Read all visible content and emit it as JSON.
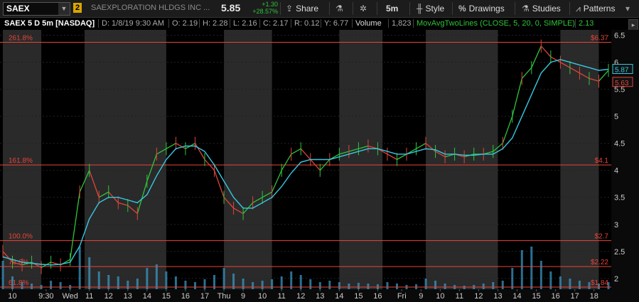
{
  "toolbar": {
    "symbol": "SAEX",
    "link_badge": "2",
    "company": "SAEXPLORATION HLDGS INC ...",
    "last": "5.85",
    "change_abs": "+1.30",
    "change_pct": "+28.57%",
    "share": "Share",
    "timeframe": "5m",
    "style": "Style",
    "drawings": "Drawings",
    "studies": "Studies",
    "patterns": "Patterns"
  },
  "info": {
    "title": "SAEX 5 D 5m [NASDAQ]",
    "d": "D: 1/8/19 9:30 AM",
    "o": "O: 2.19",
    "h": "H: 2.28",
    "l": "L: 2.16",
    "c": "C: 2.17",
    "r": "R: 0.12",
    "y": "Y: 6.77",
    "volume_label": "Volume",
    "volume_value": "1,823",
    "study": "MovAvgTwoLines (CLOSE, 5, 20, 0, SIMPLE)",
    "study_value": "2.13"
  },
  "colors": {
    "up": "#2fc43a",
    "down": "#e0443a",
    "ma_fast": "#e0443a",
    "ma_slow": "#37c8e0",
    "fib": "#e8443a",
    "volume": "#3aa0d0"
  },
  "chart_data": {
    "type": "line",
    "title": "SAEX 5 D 5m [NASDAQ]",
    "ylim": [
      1.8,
      6.6
    ],
    "y_ticks": [
      "2",
      "2.5",
      "3",
      "3.5",
      "4",
      "4.5",
      "5",
      "5.5",
      "6",
      "6.5"
    ],
    "y_tick_values": [
      2,
      2.5,
      3,
      3.5,
      4,
      4.5,
      5,
      5.5,
      6,
      6.5
    ],
    "x_tick_labels": [
      "10",
      "9:30",
      "Wed",
      "11",
      "12",
      "13",
      "14",
      "15",
      "16",
      "17",
      "Thu",
      "9",
      "10",
      "11",
      "12",
      "13",
      "14",
      "15",
      "16",
      "Fri",
      "9",
      "10",
      "11",
      "12",
      "13",
      "14",
      "15",
      "16",
      "17",
      "18"
    ],
    "x_tick_index": [
      4,
      18,
      28,
      36,
      44,
      52,
      60,
      68,
      76,
      84,
      92,
      100,
      108,
      116,
      124,
      132,
      140,
      148,
      156,
      166,
      174,
      182,
      190,
      198,
      206,
      214,
      222,
      230,
      238,
      246
    ],
    "fib_levels": [
      {
        "label": "261.8%",
        "price": 6.37,
        "price_label": "$6.37"
      },
      {
        "label": "161.8%",
        "price": 4.1,
        "price_label": "$4.1"
      },
      {
        "label": "100.0%",
        "price": 2.7,
        "price_label": "$2.7"
      },
      {
        "label": "78.6%",
        "price": 2.22,
        "price_label": "$2.22"
      },
      {
        "label": "61.8%",
        "price": 1.84,
        "price_label": "$1.84"
      }
    ],
    "price_tags": [
      {
        "value": 5.87,
        "text": "5.87",
        "color": "#37c8e0"
      },
      {
        "value": 5.63,
        "text": "5.63",
        "color": "#e0443a"
      }
    ],
    "shaded_ranges": [
      [
        0,
        16
      ],
      [
        34,
        68
      ],
      [
        92,
        112
      ],
      [
        140,
        158
      ],
      [
        176,
        206
      ],
      [
        232,
        248
      ]
    ],
    "x": [
      0,
      4,
      8,
      12,
      16,
      20,
      24,
      28,
      32,
      36,
      40,
      44,
      48,
      52,
      56,
      60,
      64,
      68,
      72,
      76,
      80,
      84,
      88,
      92,
      96,
      100,
      104,
      108,
      112,
      116,
      120,
      124,
      128,
      132,
      136,
      140,
      144,
      148,
      152,
      156,
      160,
      164,
      168,
      172,
      176,
      180,
      184,
      188,
      192,
      196,
      200,
      204,
      208,
      212,
      216,
      220,
      224,
      228,
      232,
      236,
      240,
      244,
      248,
      252
    ],
    "series": [
      {
        "name": "SAEX",
        "values": [
          2.5,
          2.3,
          2.25,
          2.3,
          2.2,
          2.3,
          2.25,
          2.35,
          3.6,
          4.0,
          3.5,
          3.6,
          3.4,
          3.35,
          3.2,
          3.8,
          4.3,
          4.4,
          4.5,
          4.4,
          4.5,
          4.2,
          4.0,
          3.5,
          3.3,
          3.2,
          3.4,
          3.5,
          3.6,
          4.0,
          4.3,
          4.4,
          4.2,
          4.0,
          4.2,
          4.3,
          4.35,
          4.4,
          4.45,
          4.4,
          4.3,
          4.2,
          4.3,
          4.4,
          4.5,
          4.35,
          4.25,
          4.3,
          4.25,
          4.3,
          4.3,
          4.35,
          4.5,
          5.0,
          5.7,
          5.9,
          6.3,
          6.1,
          6.0,
          5.9,
          5.8,
          5.7,
          5.65,
          5.85
        ]
      },
      {
        "name": "MovAvgTwoLines",
        "values": [
          2.4,
          2.35,
          2.3,
          2.28,
          2.26,
          2.25,
          2.26,
          2.3,
          2.6,
          3.1,
          3.4,
          3.5,
          3.5,
          3.45,
          3.4,
          3.55,
          3.9,
          4.2,
          4.4,
          4.45,
          4.45,
          4.35,
          4.1,
          3.8,
          3.5,
          3.3,
          3.3,
          3.4,
          3.5,
          3.7,
          3.95,
          4.15,
          4.2,
          4.2,
          4.2,
          4.25,
          4.3,
          4.35,
          4.4,
          4.4,
          4.35,
          4.3,
          4.3,
          4.35,
          4.4,
          4.38,
          4.3,
          4.3,
          4.28,
          4.28,
          4.3,
          4.3,
          4.4,
          4.6,
          5.0,
          5.4,
          5.8,
          6.0,
          6.05,
          6.0,
          5.95,
          5.9,
          5.85,
          5.87
        ]
      }
    ],
    "volume": [
      40,
      18,
      10,
      8,
      6,
      12,
      10,
      6,
      60,
      45,
      25,
      20,
      18,
      12,
      15,
      30,
      35,
      25,
      18,
      12,
      10,
      14,
      20,
      30,
      22,
      15,
      10,
      12,
      14,
      18,
      25,
      20,
      14,
      10,
      12,
      10,
      8,
      9,
      8,
      7,
      10,
      8,
      6,
      7,
      15,
      12,
      8,
      6,
      5,
      6,
      8,
      10,
      12,
      30,
      55,
      60,
      40,
      25,
      18,
      15,
      12,
      10,
      8,
      10
    ]
  }
}
